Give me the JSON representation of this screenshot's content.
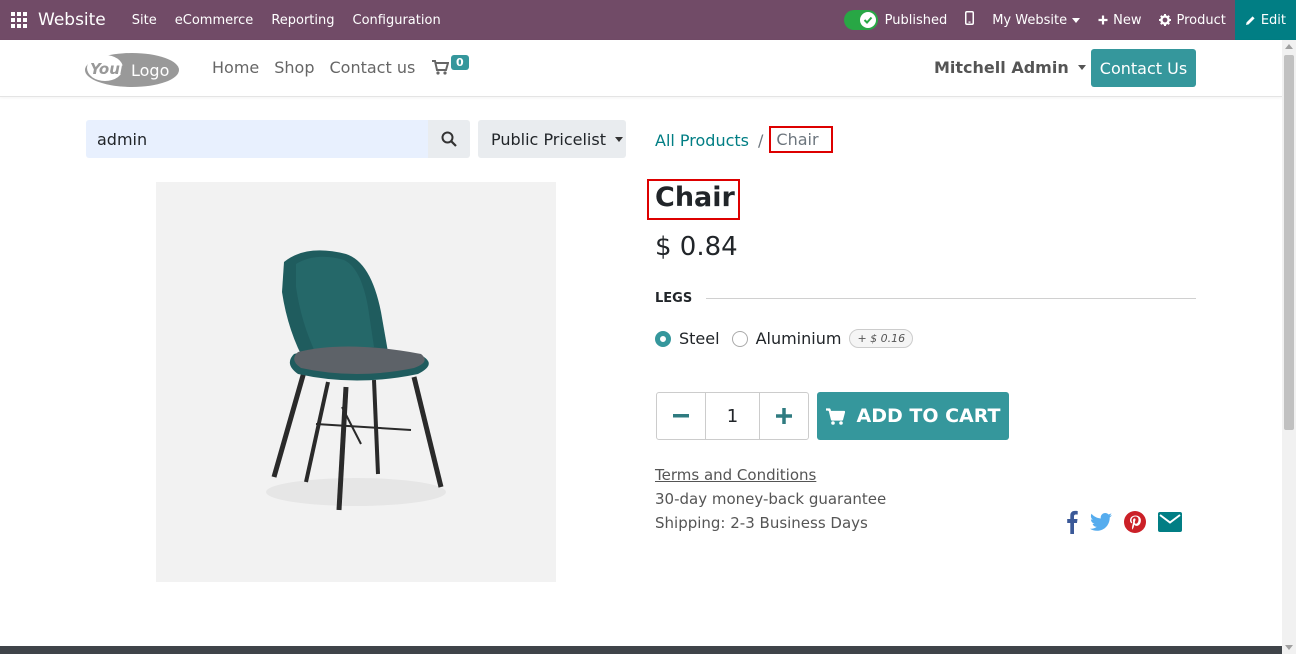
{
  "admin_bar": {
    "app_name": "Website",
    "menus": [
      "Site",
      "eCommerce",
      "Reporting",
      "Configuration"
    ],
    "published_label": "Published",
    "my_website_label": "My Website",
    "new_label": "New",
    "product_label": "Product",
    "edit_label": "Edit"
  },
  "navbar": {
    "logo_text": "YourLogo",
    "links": [
      "Home",
      "Shop",
      "Contact us"
    ],
    "cart_count": "0",
    "user_name": "Mitchell Admin",
    "contact_button": "Contact Us"
  },
  "search": {
    "value": "admin",
    "pricelist": "Public Pricelist"
  },
  "breadcrumb": {
    "parent": "All Products",
    "separator": "/",
    "current": "Chair"
  },
  "product": {
    "name": "Chair",
    "price": "$ 0.84",
    "attribute_label": "LEGS",
    "options": [
      {
        "label": "Steel",
        "selected": true
      },
      {
        "label": "Aluminium",
        "selected": false,
        "extra": "+ $ 0.16"
      }
    ],
    "quantity": "1",
    "add_to_cart": "ADD TO CART",
    "terms": "Terms and Conditions",
    "guarantee": "30-day money-back guarantee",
    "shipping": "Shipping: 2-3 Business Days"
  },
  "colors": {
    "admin_bar": "#714b67",
    "primary": "#35979c",
    "edit_button": "#017e84",
    "highlight_border": "#dd0000",
    "facebook": "#3b5998",
    "twitter": "#55acee",
    "pinterest": "#cb2027",
    "email": "#017e84"
  },
  "icons": [
    "apps-icon",
    "toggle-check-icon",
    "mobile-icon",
    "plus-icon",
    "gear-icon",
    "pencil-icon",
    "cart-icon",
    "search-icon",
    "minus-icon",
    "facebook-icon",
    "twitter-icon",
    "pinterest-icon",
    "envelope-icon"
  ]
}
